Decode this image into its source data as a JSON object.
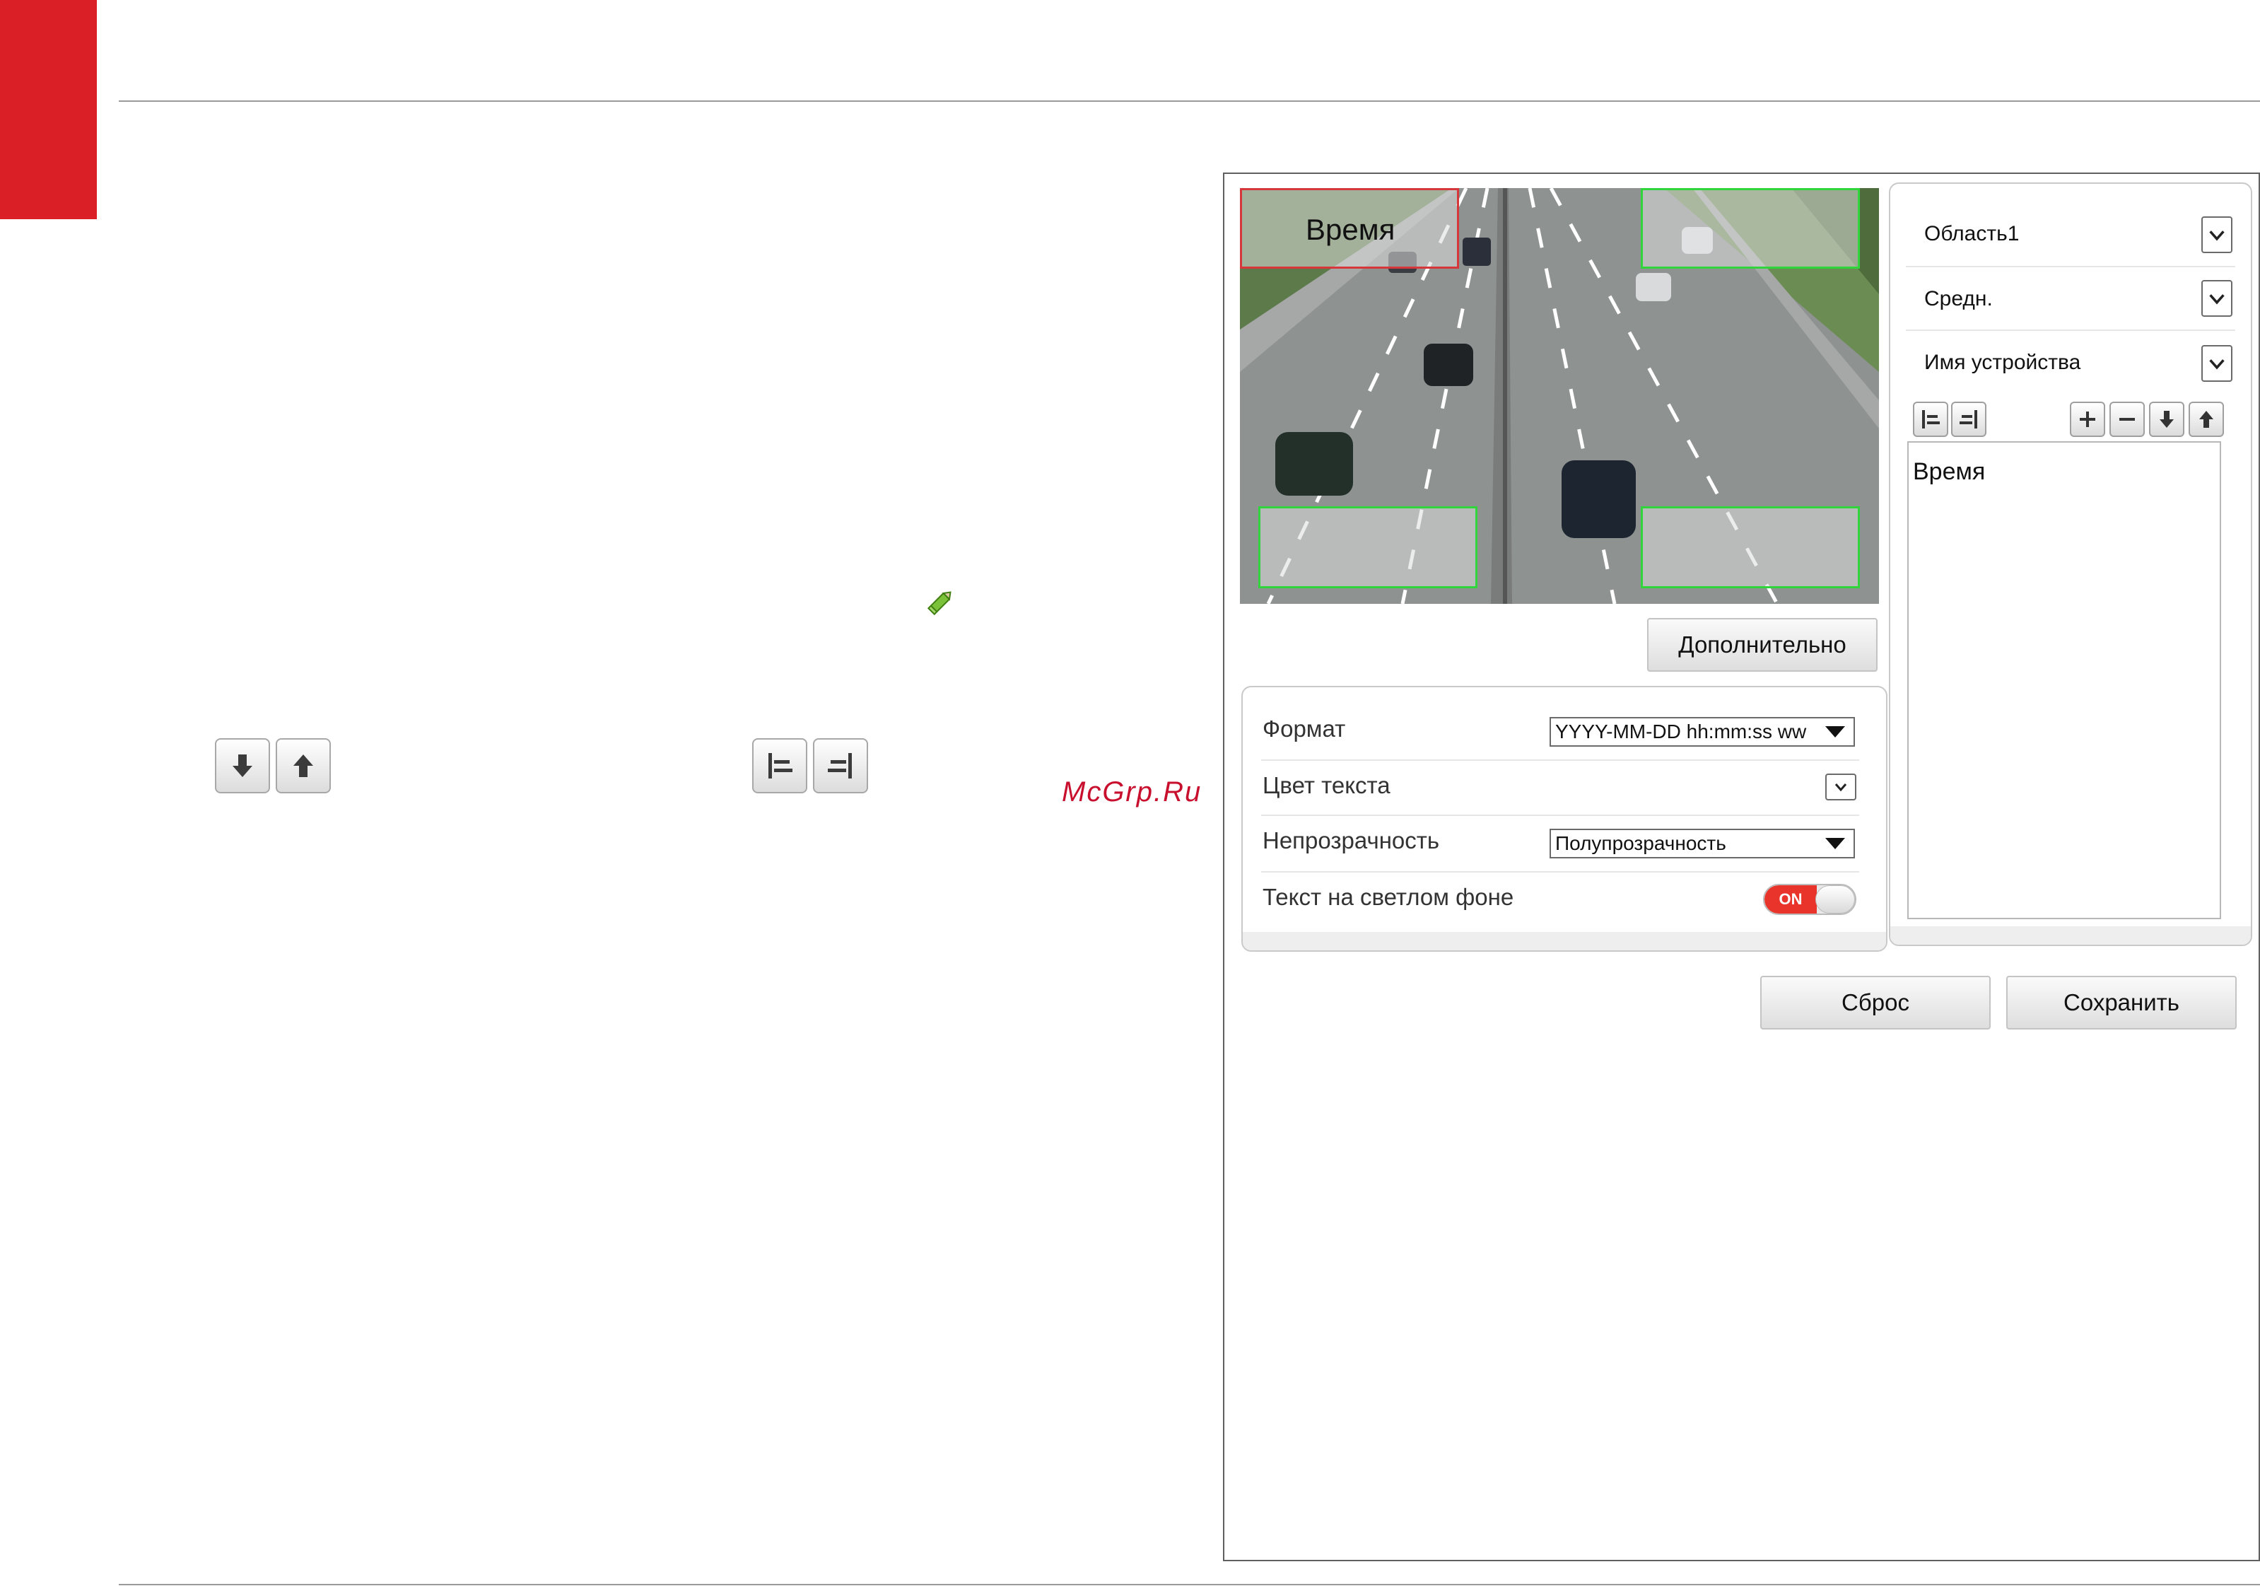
{
  "watermark": "McGrp.Ru",
  "video": {
    "regions": [
      {
        "label": "Время"
      }
    ]
  },
  "advanced_button": "Дополнительно",
  "settings": {
    "format_label": "Формат",
    "format_value": "YYYY-MM-DD hh:mm:ss ww",
    "text_color_label": "Цвет текста",
    "text_color_value": "",
    "opacity_label": "Непрозрачность",
    "opacity_value": "Полупрозрачность",
    "light_bg_label": "Текст на светлом фоне",
    "light_bg_toggle": "ON"
  },
  "right_panel": {
    "area_select": "Область1",
    "size_select": "Средн.",
    "content_select": "Имя устройства",
    "text_content": "Время"
  },
  "buttons": {
    "reset": "Сброс",
    "save": "Сохранить"
  },
  "colors": {
    "accent_red": "#db1f26",
    "roi_green": "#2fd53a",
    "roi_red": "#d6373a",
    "toggle_on": "#e8342a"
  },
  "icons": [
    "pencil-icon",
    "move-down-icon",
    "move-up-icon",
    "align-left-icon",
    "align-right-icon",
    "plus-icon",
    "minus-icon",
    "chevron-down-icon"
  ]
}
